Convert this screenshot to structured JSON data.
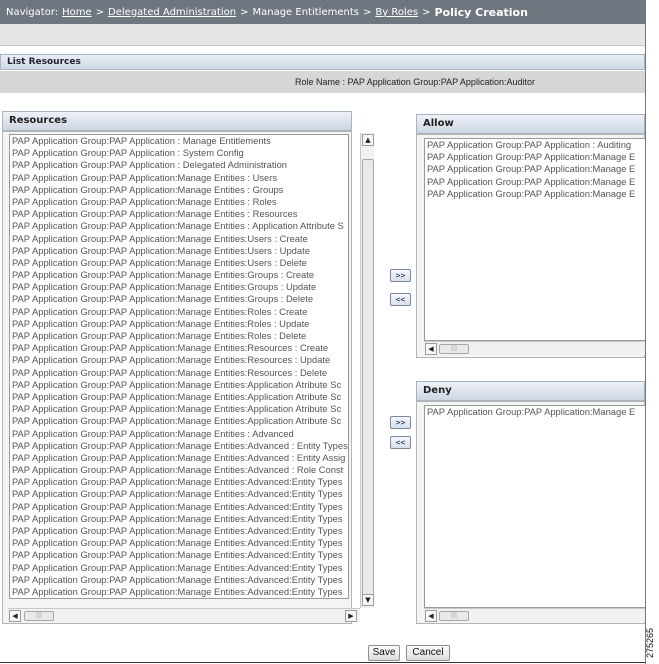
{
  "navigator": {
    "label": "Navigator:",
    "sep": ">",
    "crumbs": {
      "home": "Home",
      "delegated_admin": "Delegated Administration",
      "manage_entitlements": "Manage Entitlements",
      "by_roles": "By Roles",
      "current": "Policy Creation"
    }
  },
  "list_resources": {
    "title": "List Resources"
  },
  "role": {
    "text": "Role Name : PAP Application Group:PAP Application:Auditor"
  },
  "resources": {
    "title": "Resources",
    "items": [
      "PAP Application Group:PAP Application : Manage Entitlements",
      "PAP Application Group:PAP Application : System Config",
      "PAP Application Group:PAP Application : Delegated Administration",
      "PAP Application Group:PAP Application:Manage Entities : Users",
      "PAP Application Group:PAP Application:Manage Entities : Groups",
      "PAP Application Group:PAP Application:Manage Entities : Roles",
      "PAP Application Group:PAP Application:Manage Entities : Resources",
      "PAP Application Group:PAP Application:Manage Entities : Application Attribute S",
      "PAP Application Group:PAP Application:Manage Entities:Users : Create",
      "PAP Application Group:PAP Application:Manage Entities:Users : Update",
      "PAP Application Group:PAP Application:Manage Entities:Users : Delete",
      "PAP Application Group:PAP Application:Manage Entities:Groups : Create",
      "PAP Application Group:PAP Application:Manage Entities:Groups : Update",
      "PAP Application Group:PAP Application:Manage Entities:Groups : Delete",
      "PAP Application Group:PAP Application:Manage Entities:Roles : Create",
      "PAP Application Group:PAP Application:Manage Entities:Roles : Update",
      "PAP Application Group:PAP Application:Manage Entities:Roles : Delete",
      "PAP Application Group:PAP Application:Manage Entities:Resources : Create",
      "PAP Application Group:PAP Application:Manage Entities:Resources : Update",
      "PAP Application Group:PAP Application:Manage Entities:Resources : Delete",
      "PAP Application Group:PAP Application:Manage Entities:Application Atribute Sc",
      "PAP Application Group:PAP Application:Manage Entities:Application Atribute Sc",
      "PAP Application Group:PAP Application:Manage Entities:Application Atribute Sc",
      "PAP Application Group:PAP Application:Manage Entities:Application Atribute Sc",
      "PAP Application Group:PAP Application:Manage Entities : Advanced",
      "PAP Application Group:PAP Application:Manage Entities:Advanced : Entity Types",
      "PAP Application Group:PAP Application:Manage Entities:Advanced : Entity Assig",
      "PAP Application Group:PAP Application:Manage Entities:Advanced : Role Const",
      "PAP Application Group:PAP Application:Manage Entities:Advanced:Entity Types",
      "PAP Application Group:PAP Application:Manage Entities:Advanced:Entity Types",
      "PAP Application Group:PAP Application:Manage Entities:Advanced:Entity Types",
      "PAP Application Group:PAP Application:Manage Entities:Advanced:Entity Types",
      "PAP Application Group:PAP Application:Manage Entities:Advanced:Entity Types",
      "PAP Application Group:PAP Application:Manage Entities:Advanced:Entity Types",
      "PAP Application Group:PAP Application:Manage Entities:Advanced:Entity Types",
      "PAP Application Group:PAP Application:Manage Entities:Advanced:Entity Types",
      "PAP Application Group:PAP Application:Manage Entities:Advanced:Entity Types",
      "PAP Application Group:PAP Application:Manage Entities:Advanced:Entity Types"
    ]
  },
  "allow": {
    "title": "Allow",
    "items": [
      "PAP Application Group:PAP Application : Auditing",
      "PAP Application Group:PAP Application:Manage E",
      "PAP Application Group:PAP Application:Manage E",
      "PAP Application Group:PAP Application:Manage E",
      "PAP Application Group:PAP Application:Manage E"
    ]
  },
  "deny": {
    "title": "Deny",
    "items": [
      "PAP Application Group:PAP Application:Manage E"
    ]
  },
  "transfer": {
    "add": ">>",
    "remove": "<<"
  },
  "actions": {
    "save": "Save",
    "cancel": "Cancel"
  },
  "figure_number": "275265"
}
